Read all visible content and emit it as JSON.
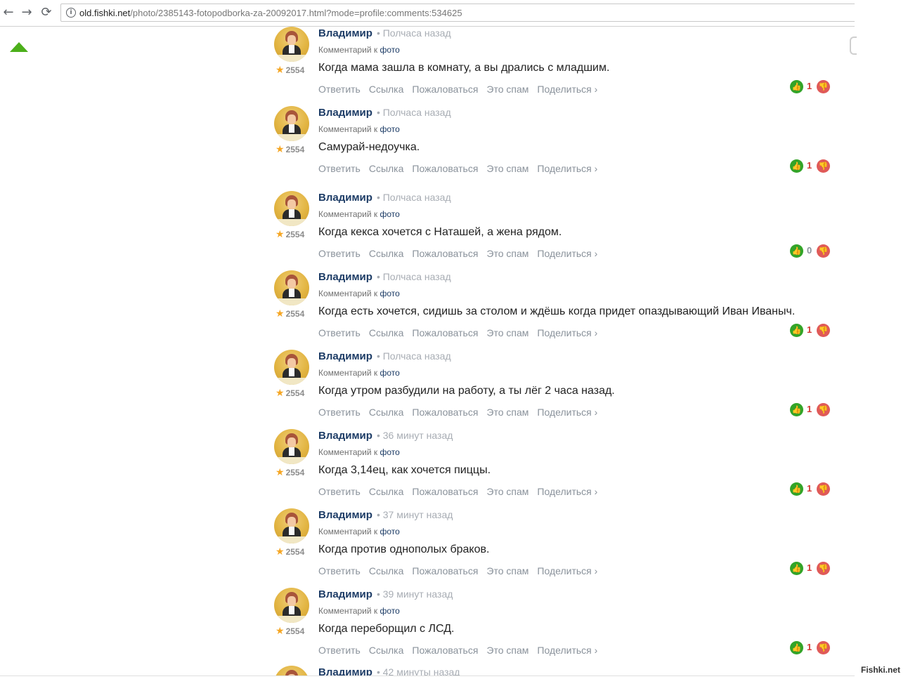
{
  "browser": {
    "back_icon": "←",
    "forward_icon": "→",
    "reload_icon": "⟳",
    "info_icon": "i",
    "url_host": "old.fishki.net",
    "url_path": "/photo/2385143-fotopodborka-za-20092017.html?mode=profile:comments:534625"
  },
  "labels": {
    "commented_on": "Комментарий к",
    "photo": "фото",
    "reply": "Ответить",
    "link": "Ссылка",
    "report": "Пожаловаться",
    "spam": "Это спам",
    "share": "Поделиться ›",
    "like_icon": "👍",
    "dislike_icon": "👎"
  },
  "comments": [
    {
      "author": "Владимир",
      "time": "• Полчаса назад",
      "rating": "2554",
      "text": "Когда мама зашла в комнату, а вы дрались с младшим.",
      "votes": "1"
    },
    {
      "author": "Владимир",
      "time": "• Полчаса назад",
      "rating": "2554",
      "text": "Самурай-недоучка.",
      "votes": "1"
    },
    {
      "author": "Владимир",
      "time": "• Полчаса назад",
      "rating": "2554",
      "text": "Когда кекса хочется с Наташей, а жена рядом.",
      "votes": "0"
    },
    {
      "author": "Владимир",
      "time": "• Полчаса назад",
      "rating": "2554",
      "text": "Когда есть хочется, сидишь за столом и ждёшь когда придет опаздывающий Иван Иваныч.",
      "votes": "1"
    },
    {
      "author": "Владимир",
      "time": "• Полчаса назад",
      "rating": "2554",
      "text": "Когда утром разбудили на работу, а ты лёг 2 часа назад.",
      "votes": "1"
    },
    {
      "author": "Владимир",
      "time": "• 36 минут назад",
      "rating": "2554",
      "text": "Когда 3,14ец, как хочется пиццы.",
      "votes": "1"
    },
    {
      "author": "Владимир",
      "time": "• 37 минут назад",
      "rating": "2554",
      "text": "Когда против однополых браков.",
      "votes": "1"
    },
    {
      "author": "Владимир",
      "time": "• 39 минут назад",
      "rating": "2554",
      "text": "Когда переборщил с ЛСД.",
      "votes": "1"
    }
  ],
  "partial_comment": {
    "author": "Владимир",
    "time": "• 42 минуты назад"
  },
  "watermark": "Fishki.net"
}
